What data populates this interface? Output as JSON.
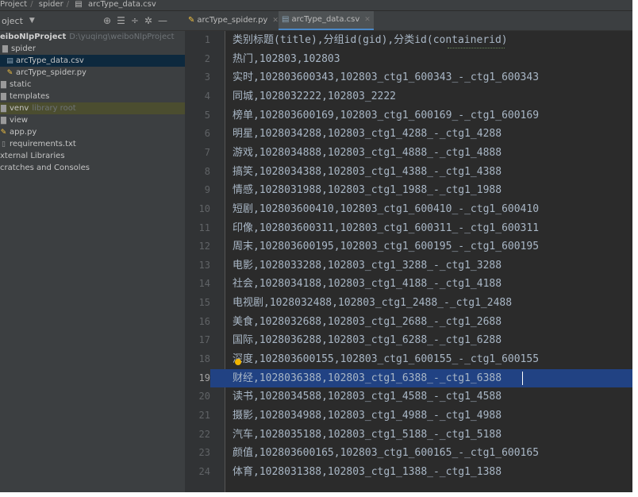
{
  "breadcrumb": [
    "Project",
    "spider",
    "arcType_data.csv"
  ],
  "project_panel": {
    "title": "oject",
    "tools": [
      "⊕",
      "☰",
      "÷",
      "✲",
      "—"
    ]
  },
  "tree": [
    {
      "icon": "",
      "label": "eiboNlpProject",
      "extra": "D:\\yuqing\\weiboNlpProject",
      "kind": "root"
    },
    {
      "icon": "folder-icon",
      "label": "spider",
      "extra": "",
      "kind": "folder"
    },
    {
      "icon": "csv-file-icon",
      "label": "arcType_data.csv",
      "extra": "",
      "kind": "file-selected"
    },
    {
      "icon": "python-file-icon",
      "label": "arcType_spider.py",
      "extra": "",
      "kind": "file"
    },
    {
      "icon": "folder-icon",
      "label": "static",
      "extra": "",
      "kind": "folder"
    },
    {
      "icon": "folder-icon",
      "label": "templates",
      "extra": "",
      "kind": "folder"
    },
    {
      "icon": "folder-icon",
      "label": "venv",
      "extra": "library root",
      "kind": "venv"
    },
    {
      "icon": "folder-icon",
      "label": "view",
      "extra": "",
      "kind": "folder"
    },
    {
      "icon": "python-file-icon",
      "label": "app.py",
      "extra": "",
      "kind": "file"
    },
    {
      "icon": "text-file-icon",
      "label": "requirements.txt",
      "extra": "",
      "kind": "file"
    },
    {
      "icon": "",
      "label": "xternal Libraries",
      "extra": "",
      "kind": "lib"
    },
    {
      "icon": "",
      "label": "cratches and Consoles",
      "extra": "",
      "kind": "lib"
    }
  ],
  "tabs": [
    {
      "label": "arcType_spider.py",
      "icon": "python-file-icon",
      "active": false
    },
    {
      "label": "arcType_data.csv",
      "icon": "csv-file-icon",
      "active": true
    }
  ],
  "editor": {
    "current_line": 19,
    "lines": [
      {
        "n": "1",
        "text": "类别标题(title),分组id(gid),分类id(containerid)"
      },
      {
        "n": "2",
        "text": "热门,102803,102803"
      },
      {
        "n": "3",
        "text": "实时,102803600343,102803_ctg1_600343_-_ctg1_600343"
      },
      {
        "n": "4",
        "text": "同城,1028032222,102803_2222"
      },
      {
        "n": "5",
        "text": "榜单,102803600169,102803_ctg1_600169_-_ctg1_600169"
      },
      {
        "n": "6",
        "text": "明星,1028034288,102803_ctg1_4288_-_ctg1_4288"
      },
      {
        "n": "7",
        "text": "游戏,1028034888,102803_ctg1_4888_-_ctg1_4888"
      },
      {
        "n": "8",
        "text": "搞笑,1028034388,102803_ctg1_4388_-_ctg1_4388"
      },
      {
        "n": "9",
        "text": "情感,1028031988,102803_ctg1_1988_-_ctg1_1988"
      },
      {
        "n": "10",
        "text": "短剧,102803600410,102803_ctg1_600410_-_ctg1_600410"
      },
      {
        "n": "11",
        "text": "印像,102803600311,102803_ctg1_600311_-_ctg1_600311"
      },
      {
        "n": "12",
        "text": "周末,102803600195,102803_ctg1_600195_-_ctg1_600195"
      },
      {
        "n": "13",
        "text": "电影,1028033288,102803_ctg1_3288_-_ctg1_3288"
      },
      {
        "n": "14",
        "text": "社会,1028034188,102803_ctg1_4188_-_ctg1_4188"
      },
      {
        "n": "15",
        "text": "电视剧,1028032488,102803_ctg1_2488_-_ctg1_2488"
      },
      {
        "n": "16",
        "text": "美食,1028032688,102803_ctg1_2688_-_ctg1_2688"
      },
      {
        "n": "17",
        "text": "国际,1028036288,102803_ctg1_6288_-_ctg1_6288"
      },
      {
        "n": "18",
        "text": "深度,102803600155,102803_ctg1_600155_-_ctg1_600155"
      },
      {
        "n": "19",
        "text": "财经,1028036388,102803_ctg1_6388_-_ctg1_6388"
      },
      {
        "n": "20",
        "text": "读书,1028034588,102803_ctg1_4588_-_ctg1_4588"
      },
      {
        "n": "21",
        "text": "摄影,1028034988,102803_ctg1_4988_-_ctg1_4988"
      },
      {
        "n": "22",
        "text": "汽车,1028035188,102803_ctg1_5188_-_ctg1_5188"
      },
      {
        "n": "23",
        "text": "颜值,102803600165,102803_ctg1_600165_-_ctg1_600165"
      },
      {
        "n": "24",
        "text": "体育,1028031388,102803_ctg1_1388_-_ctg1_1388"
      }
    ]
  },
  "colors": {
    "editor_bg": "#2b2b2b",
    "panel_bg": "#3c3f41",
    "current_line": "#214283",
    "text": "#a9b7c6"
  }
}
